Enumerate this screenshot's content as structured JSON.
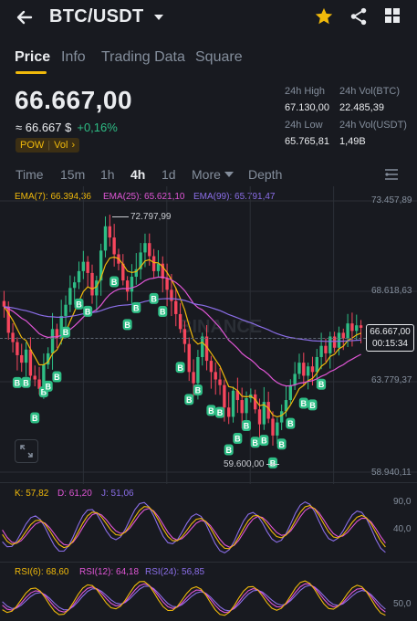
{
  "header": {
    "pair": "BTC/USDT",
    "icons": [
      "back-arrow-icon",
      "chevron-down-icon",
      "star-icon",
      "share-icon",
      "grid-icon"
    ]
  },
  "tabs": [
    {
      "label": "Price",
      "active": true
    },
    {
      "label": "Info",
      "active": false
    },
    {
      "label": "Trading Data",
      "active": false
    },
    {
      "label": "Square",
      "active": false
    }
  ],
  "price": {
    "last": "66.667,00",
    "approx": "≈ 66.667 $",
    "change": "+0,16%",
    "badge_pow": "POW",
    "badge_vol": "Vol",
    "badge_arrow": "›"
  },
  "stats": {
    "high_label": "24h High",
    "high_value": "67.130,00",
    "volbtc_label": "24h Vol(BTC)",
    "volbtc_value": "22.485,39",
    "low_label": "24h Low",
    "low_value": "65.765,81",
    "volusdt_label": "24h Vol(USDT)",
    "volusdt_value": "1,49B"
  },
  "timeframes": {
    "time": "Time",
    "m15": "15m",
    "h1": "1h",
    "h4": "4h",
    "d1": "1d",
    "more": "More",
    "depth": "Depth",
    "active": "4h"
  },
  "ema": {
    "ema7": "EMA(7): 66.394,36",
    "ema25": "EMA(25): 65.621,10",
    "ema99": "EMA(99): 65.791,47",
    "color7": "#f0b90b",
    "color25": "#e056d6",
    "color99": "#8b6ee8"
  },
  "price_axis": {
    "p1": "73.457,89",
    "p2": "68.618,63",
    "p3": "63.779,37",
    "p4": "58.940,11",
    "current": "66.667,00",
    "countdown": "00:15:34",
    "max_marker": "72.797,99",
    "min_marker": "59.600,00"
  },
  "kdj": {
    "k": "K: 57,82",
    "d": "D: 61,20",
    "j": "J: 51,06",
    "ax_hi": "90,0",
    "ax_lo": "40,0"
  },
  "rsi": {
    "r6": "RSI(6): 68,60",
    "r12": "RSI(12): 64,18",
    "r24": "RSI(24): 56,85",
    "ax": "50,0"
  },
  "watermark": "BINANCE",
  "colors": {
    "up": "#2ebd85",
    "down": "#f6465d",
    "accent": "#f0b90b",
    "bg": "#181a20"
  },
  "chart_data": {
    "type": "candlestick",
    "timeframe": "4h",
    "y_range": [
      58940.11,
      73457.89
    ],
    "y_ticks": [
      73457.89,
      68618.63,
      63779.37,
      58940.11
    ],
    "closes": [
      67800,
      66400,
      65900,
      65200,
      64800,
      65500,
      64100,
      63900,
      63400,
      64700,
      65300,
      66600,
      66100,
      67300,
      67900,
      68800,
      69100,
      69700,
      70200,
      69600,
      68400,
      69200,
      70800,
      72100,
      71500,
      70600,
      70100,
      69200,
      68600,
      69400,
      69800,
      70700,
      71200,
      70500,
      69700,
      70100,
      69300,
      68700,
      68100,
      67400,
      66600,
      65800,
      64300,
      63700,
      65100,
      66200,
      64900,
      64300,
      63900,
      63600,
      62400,
      61900,
      63300,
      62800,
      62100,
      62900,
      63100,
      62300,
      61500,
      62700,
      61800,
      60900,
      61600,
      62200,
      62800,
      63600,
      64200,
      64800,
      64100,
      64600,
      64300,
      65100,
      65700,
      65300,
      66200,
      65600,
      66400,
      66100,
      66900,
      66500,
      66800,
      66667
    ]
  }
}
